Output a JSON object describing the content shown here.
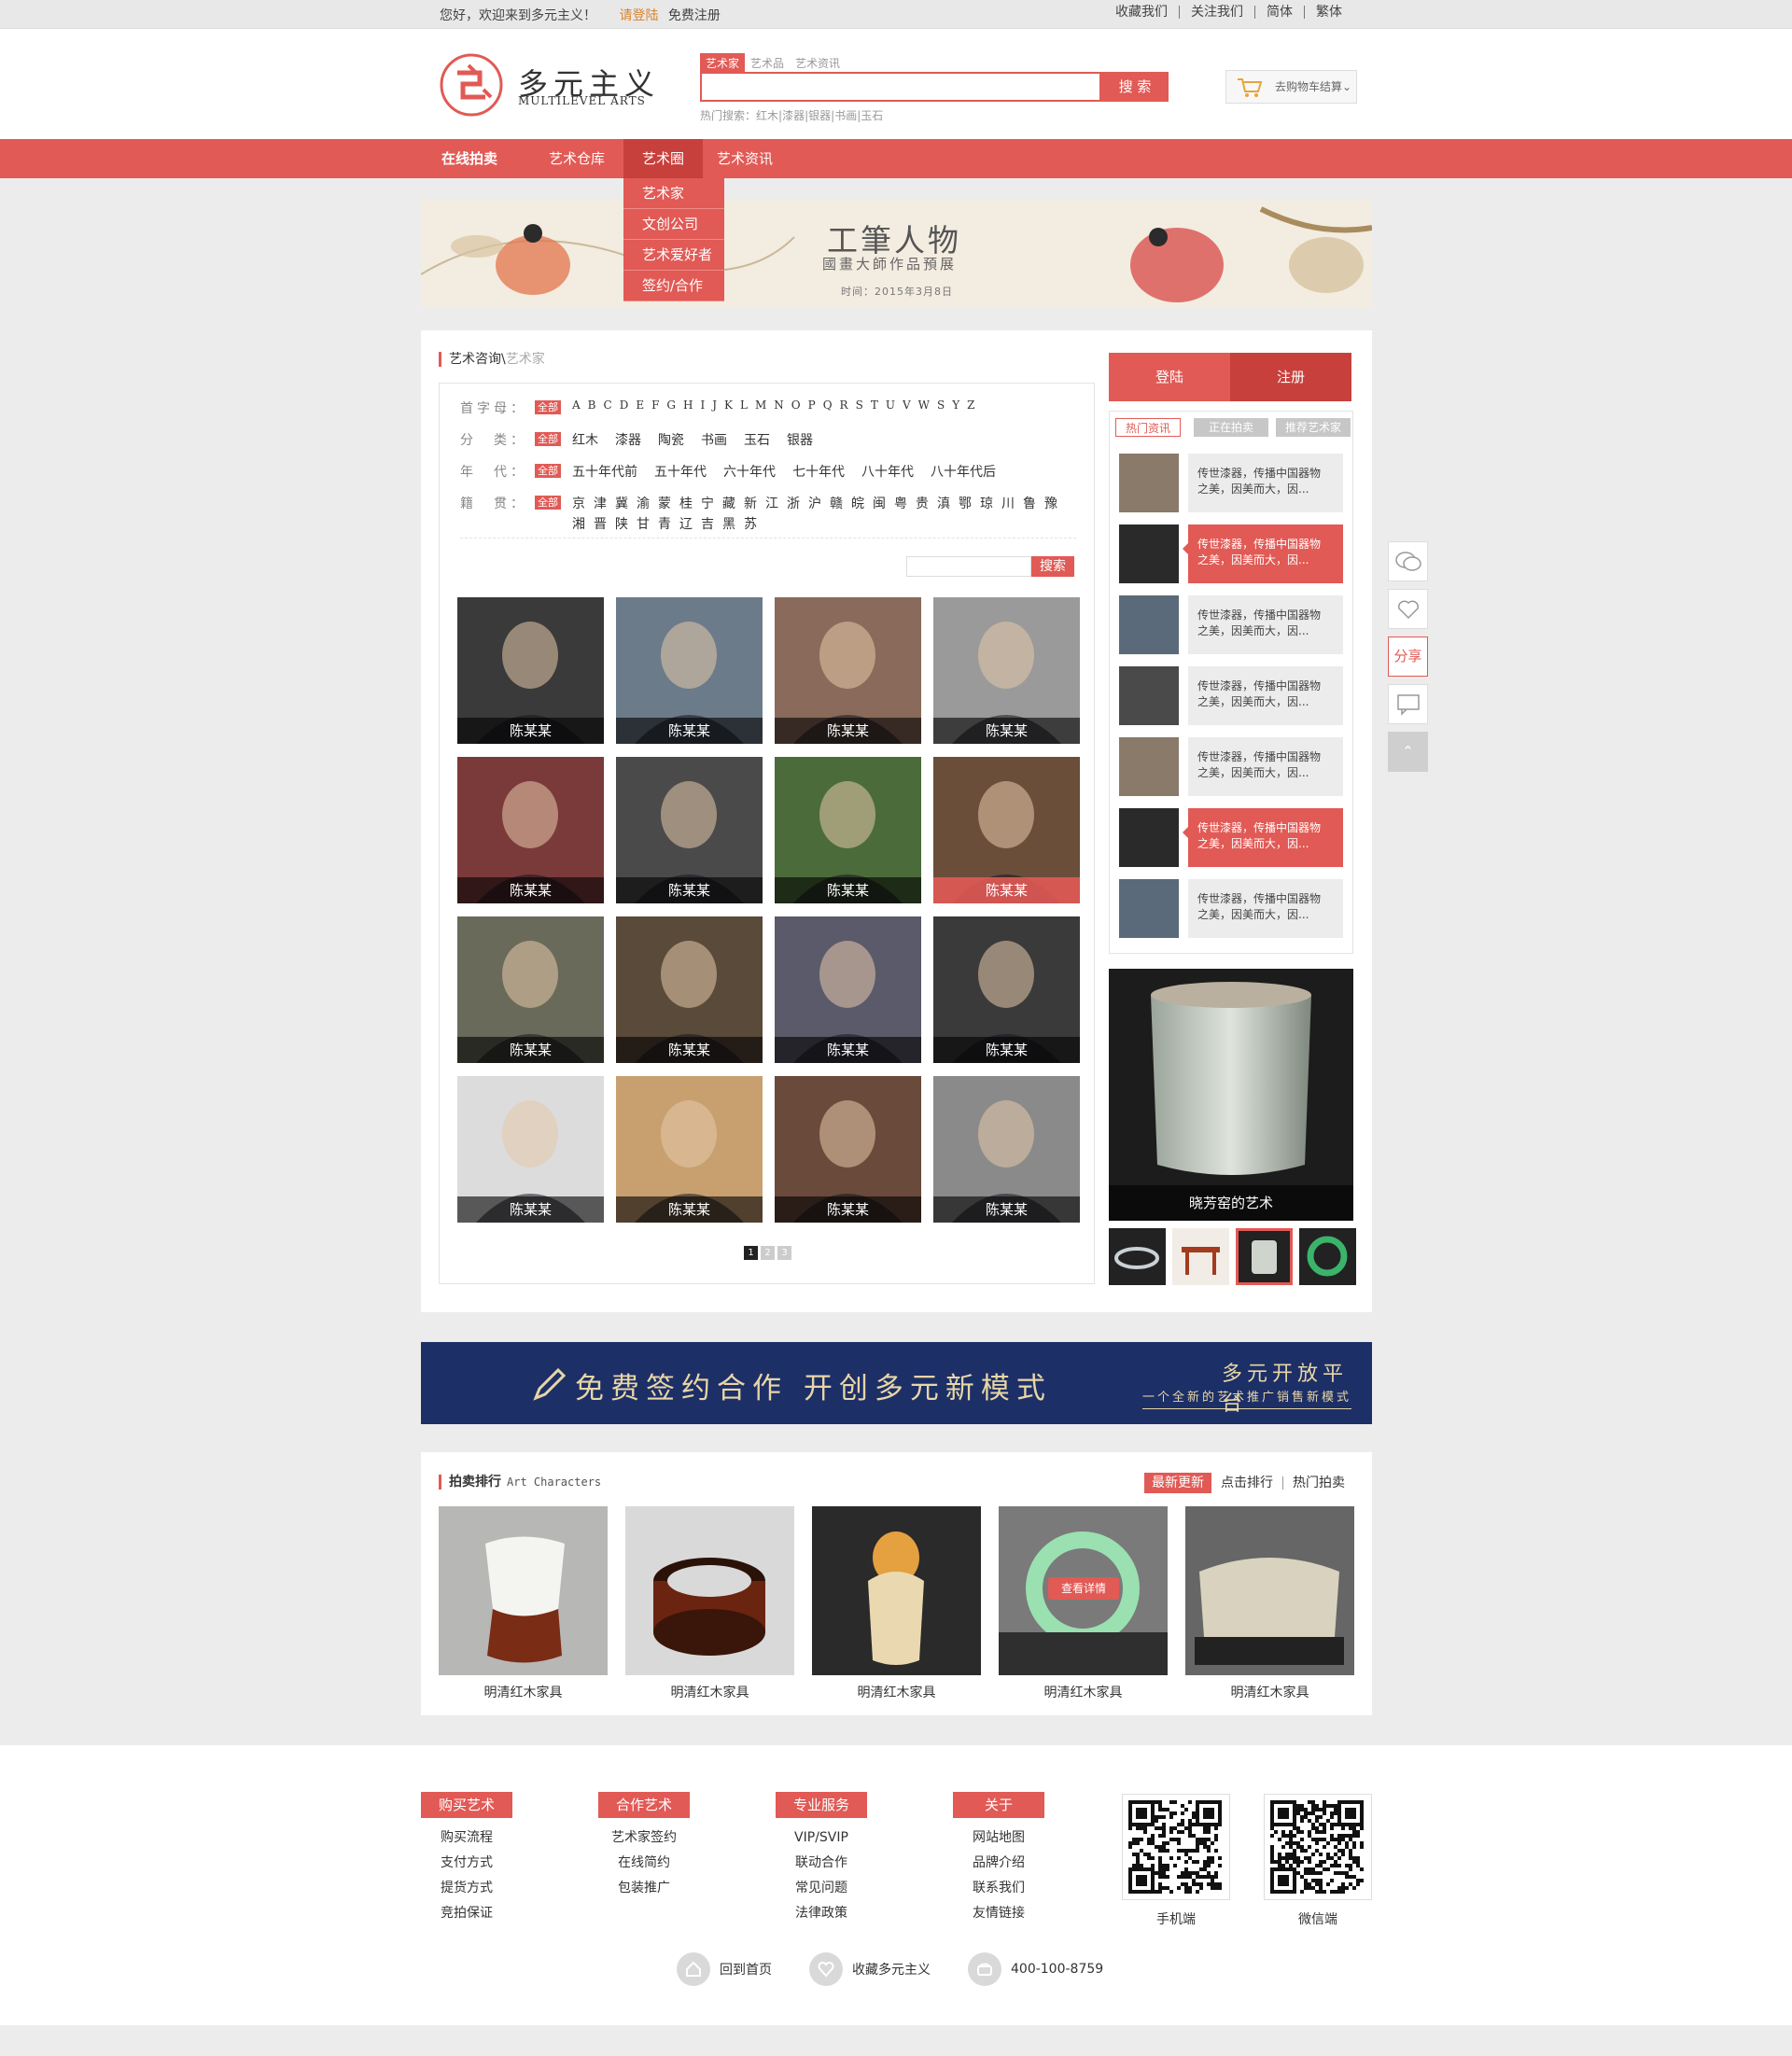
{
  "topbar": {
    "welcome": "您好，欢迎来到多元主义！",
    "login": "请登陆",
    "register": "免费注册",
    "links": [
      "收藏我们",
      "关注我们",
      "简体",
      "繁体"
    ]
  },
  "logo": {
    "cn": "多元主义",
    "en": "MULTILEVEL ARTS"
  },
  "search": {
    "tabs": [
      "艺术家",
      "艺术品",
      "艺术资讯"
    ],
    "button": "搜 索",
    "hot_label": "热门搜索：",
    "hot": [
      "红木",
      "漆器",
      "银器",
      "书画",
      "玉石"
    ]
  },
  "cart": {
    "label": "去购物车结算"
  },
  "nav": {
    "items": [
      "在线拍卖",
      "艺术仓库",
      "艺术圈",
      "艺术资讯"
    ],
    "dropdown": [
      "艺术家",
      "文创公司",
      "艺术爱好者",
      "签约/合作"
    ]
  },
  "banner": {
    "title": "工筆人物",
    "subtitle": "國畫大師作品預展",
    "date": "时间：2015年3月8日"
  },
  "section": {
    "crumb1": "艺术咨询\\",
    "crumb2": "艺术家"
  },
  "filters": {
    "all": "全部",
    "rows": [
      {
        "label": "首字母：",
        "values": [
          "A",
          "B",
          "C",
          "D",
          "E",
          "F",
          "G",
          "H",
          "I",
          "J",
          "K",
          "L",
          "M",
          "N",
          "O",
          "P",
          "Q",
          "R",
          "S",
          "T",
          "U",
          "V",
          "W",
          "S",
          "Y",
          "Z"
        ]
      },
      {
        "label": "分　类：",
        "values": [
          "红木",
          "漆器",
          "陶瓷",
          "书画",
          "玉石",
          "银器"
        ]
      },
      {
        "label": "年　代：",
        "values": [
          "五十年代前",
          "五十年代",
          "六十年代",
          "七十年代",
          "八十年代",
          "八十年代后"
        ]
      },
      {
        "label": "籍　贯：",
        "values": [
          "京",
          "津",
          "冀",
          "渝",
          "蒙",
          "桂",
          "宁",
          "藏",
          "新",
          "江",
          "浙",
          "沪",
          "赣",
          "皖",
          "闽",
          "粤",
          "贵",
          "滇",
          "鄂",
          "琼",
          "川",
          "鲁",
          "豫",
          "湘",
          "晋",
          "陕",
          "甘",
          "青",
          "辽",
          "吉",
          "黑",
          "苏"
        ]
      }
    ],
    "search_button": "搜索"
  },
  "artists": [
    "陈某某",
    "陈某某",
    "陈某某",
    "陈某某",
    "陈某某",
    "陈某某",
    "陈某某",
    "陈某某",
    "陈某某",
    "陈某某",
    "陈某某",
    "陈某某",
    "陈某某",
    "陈某某",
    "陈某某",
    "陈某某"
  ],
  "pager": [
    "1",
    "2",
    "3"
  ],
  "sidebar": {
    "login": "登陆",
    "register": "注册",
    "tabs": [
      "热门资讯",
      "正在拍卖",
      "推荐艺术家"
    ],
    "news": [
      {
        "l1": "传世漆器，传播中国器物",
        "l2": "之美，因美而大，因..."
      },
      {
        "l1": "传世漆器，传播中国器物",
        "l2": "之美，因美而大，因..."
      },
      {
        "l1": "传世漆器，传播中国器物",
        "l2": "之美，因美而大，因..."
      },
      {
        "l1": "传世漆器，传播中国器物",
        "l2": "之美，因美而大，因..."
      },
      {
        "l1": "传世漆器，传播中国器物",
        "l2": "之美，因美而大，因..."
      },
      {
        "l1": "传世漆器，传播中国器物",
        "l2": "之美，因美而大，因..."
      },
      {
        "l1": "传世漆器，传播中国器物",
        "l2": "之美，因美而大，因..."
      }
    ],
    "feature_caption": "晓芳窑的艺术"
  },
  "floatbar": {
    "share": "分享"
  },
  "promo": {
    "main": "免费签约合作 开创多元新模式",
    "right1": "多元开放平台",
    "right2": "一个全新的艺术推广销售新模式"
  },
  "auction": {
    "title": "拍卖排行",
    "title_en": "Art Characters",
    "tabs": [
      "最新更新",
      "点击排行",
      "热门拍卖"
    ],
    "detail": "查看详情",
    "items": [
      "明清红木家具",
      "明清红木家具",
      "明清红木家具",
      "明清红木家具",
      "明清红木家具"
    ]
  },
  "footer": {
    "cols": [
      {
        "title": "购买艺术",
        "items": [
          "购买流程",
          "支付方式",
          "提货方式",
          "竞拍保证"
        ]
      },
      {
        "title": "合作艺术",
        "items": [
          "艺术家签约",
          "在线简约",
          "包装推广"
        ]
      },
      {
        "title": "专业服务",
        "items": [
          "VIP/SVIP",
          "联动合作",
          "常见问题",
          "法律政策"
        ]
      },
      {
        "title": "关于",
        "items": [
          "网站地图",
          "品牌介绍",
          "联系我们",
          "友情链接"
        ]
      }
    ],
    "qr": [
      "手机端",
      "微信端"
    ],
    "links": [
      "回到首页",
      "收藏多元主义",
      "400-100-8759"
    ]
  },
  "colors": {
    "accent": "#e15a55",
    "navy": "#1d2f67",
    "gold": "#e7d6a6"
  }
}
